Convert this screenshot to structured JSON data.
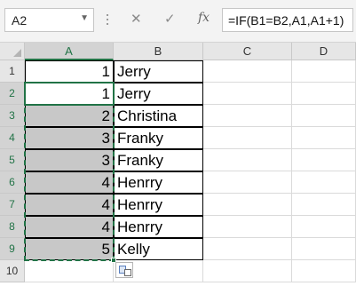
{
  "formula_bar": {
    "name_box": "A2",
    "cancel_icon": "✕",
    "enter_icon": "✓",
    "insert_function_label": "fx",
    "formula": "=IF(B1=B2,A1,A1+1)"
  },
  "columns": [
    "A",
    "B",
    "C",
    "D"
  ],
  "rows": [
    "1",
    "2",
    "3",
    "4",
    "5",
    "6",
    "7",
    "8",
    "9",
    "10"
  ],
  "cells": {
    "A": [
      "1",
      "1",
      "2",
      "3",
      "3",
      "4",
      "4",
      "4",
      "5",
      ""
    ],
    "B": [
      "Jerry",
      "Jerry",
      "Christina",
      "Franky",
      "Franky",
      "Henrry",
      "Henrry",
      "Henrry",
      "Kelly",
      ""
    ]
  },
  "colors": {
    "accent": "#217346",
    "selected_fill": "#c8c8c8",
    "header_fill": "#e6e6e6"
  }
}
